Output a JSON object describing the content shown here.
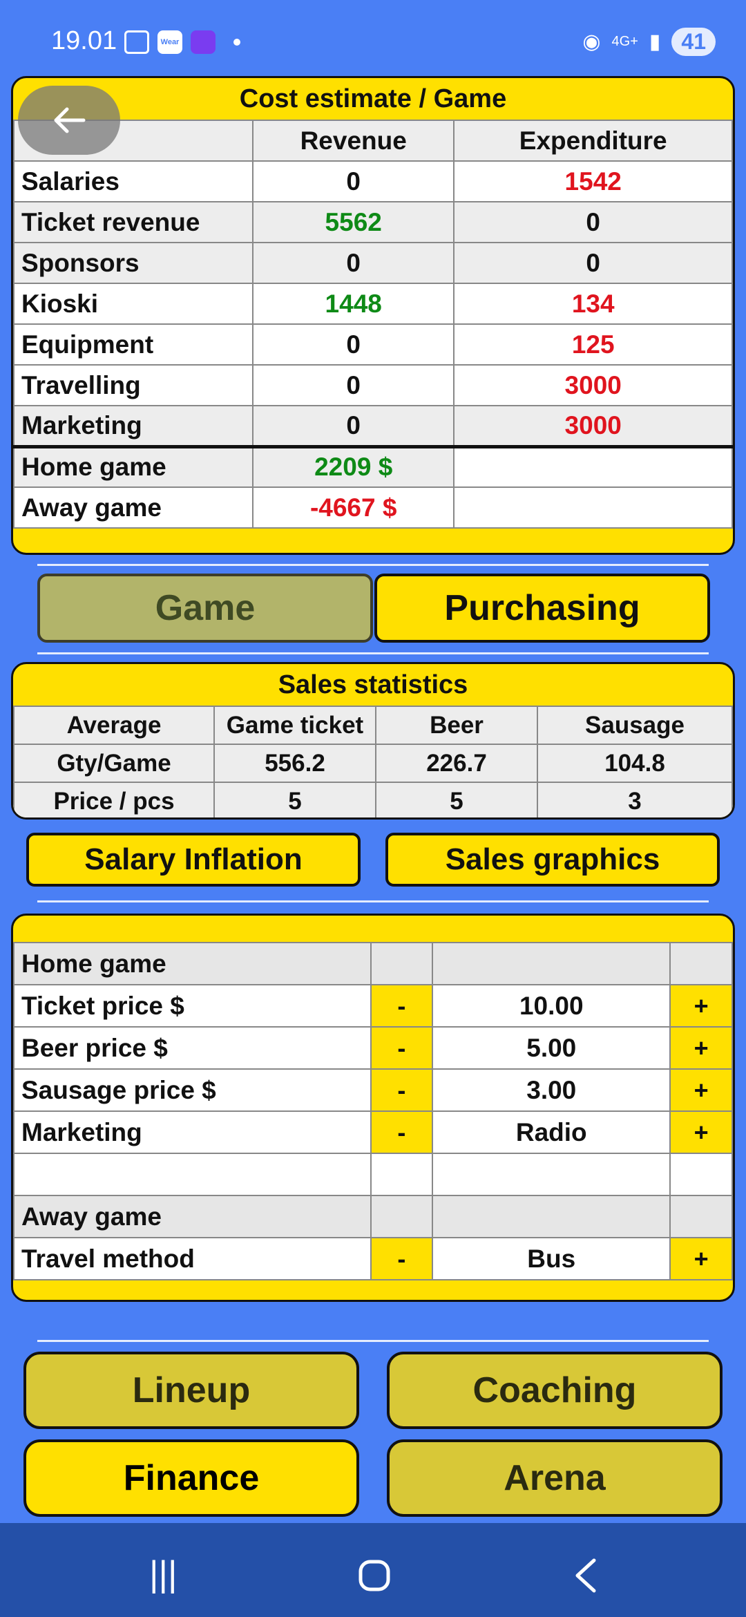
{
  "status_bar": {
    "time": "19.01",
    "battery": "41",
    "network": "4G+"
  },
  "cost_estimate": {
    "title": "Cost estimate / Game",
    "headers": [
      "",
      "Revenue",
      "Expenditure"
    ],
    "rows": [
      {
        "label": "Salaries",
        "revenue": "0",
        "expenditure": "1542"
      },
      {
        "label": "Ticket revenue",
        "revenue": "5562",
        "expenditure": "0"
      },
      {
        "label": "Sponsors",
        "revenue": "0",
        "expenditure": "0"
      },
      {
        "label": "Kioski",
        "revenue": "1448",
        "expenditure": "134"
      },
      {
        "label": "Equipment",
        "revenue": "0",
        "expenditure": "125"
      },
      {
        "label": "Travelling",
        "revenue": "0",
        "expenditure": "3000"
      },
      {
        "label": "Marketing",
        "revenue": "0",
        "expenditure": "3000"
      }
    ],
    "totals": [
      {
        "label": "Home game",
        "revenue": "2209 $",
        "expenditure": ""
      },
      {
        "label": "Away game",
        "revenue": "-4667 $",
        "expenditure": ""
      }
    ]
  },
  "tabs": {
    "game": "Game",
    "purchasing": "Purchasing"
  },
  "sales_statistics": {
    "title": "Sales statistics",
    "headers": [
      "Average",
      "Game ticket",
      "Beer",
      "Sausage"
    ],
    "rows": [
      [
        "Gty/Game",
        "556.2",
        "226.7",
        "104.8"
      ],
      [
        "Price / pcs",
        "5",
        "5",
        "3"
      ]
    ]
  },
  "buttons": {
    "salary_inflation": "Salary Inflation",
    "sales_graphics": "Sales graphics"
  },
  "settings": {
    "home_header": "Home game",
    "ticket_label": "Ticket price $",
    "ticket_value": "10.00",
    "beer_label": "Beer price $",
    "beer_value": "5.00",
    "sausage_label": "Sausage price $",
    "sausage_value": "3.00",
    "marketing_label": "Marketing",
    "marketing_value": "Radio",
    "away_header": "Away game",
    "travel_label": "Travel method",
    "travel_value": "Bus",
    "minus": "-",
    "plus": "+"
  },
  "nav": {
    "lineup": "Lineup",
    "coaching": "Coaching",
    "finance": "Finance",
    "arena": "Arena"
  },
  "colors": {
    "background": "#4A7FF5",
    "accent": "#FFE000",
    "positive": "#0E8A16",
    "negative": "#E0141E"
  }
}
